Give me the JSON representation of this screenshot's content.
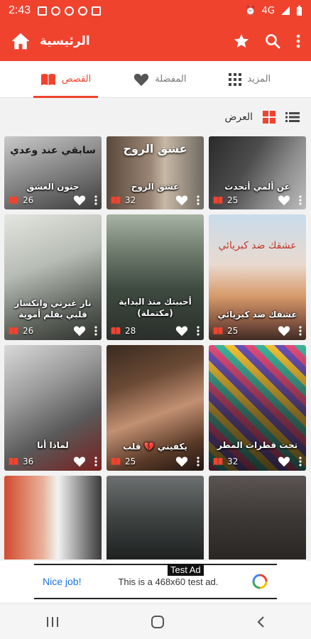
{
  "status_bar": {
    "time": "2:43",
    "signal": "4G"
  },
  "app_bar": {
    "title": "الرئيسية"
  },
  "tabs": [
    {
      "label": "المزيد"
    },
    {
      "label": "المفضلة"
    },
    {
      "label": "القصص"
    }
  ],
  "view": {
    "label": "العرض"
  },
  "stories": [
    {
      "title": "جنون العشق",
      "count": "26",
      "cover_text": "سابقي عند وعدي"
    },
    {
      "title": "عشق الروح",
      "count": "32",
      "cover_text": "عشق الروح"
    },
    {
      "title": "عن ألمي أتحدث",
      "count": "25",
      "cover_text": ""
    },
    {
      "title": "نار غيرتي وانكسار قلبي بقلم أموية",
      "count": "26",
      "cover_text": ""
    },
    {
      "title": "أحببتك منذ البداية (مكتملة)",
      "count": "28",
      "cover_text": ""
    },
    {
      "title": "عشقك ضد كبريائي",
      "count": "25",
      "cover_text": "عشقك ضد كبريائي"
    },
    {
      "title": "لماذا أنا",
      "count": "36",
      "cover_text": ""
    },
    {
      "title": "يكفيني 💔 قلب",
      "count": "25",
      "cover_text": ""
    },
    {
      "title": "تحت قطرات المطر",
      "count": "32",
      "cover_text": ""
    },
    {
      "title": "",
      "count": "",
      "cover_text": ""
    },
    {
      "title": "",
      "count": "",
      "cover_text": ""
    },
    {
      "title": "",
      "count": "",
      "cover_text": ""
    }
  ],
  "ad": {
    "tag": "Test Ad",
    "button": "Nice job!",
    "message": "This is a 468x60 test ad."
  },
  "colors": {
    "primary": "#f0432e",
    "tab_inactive": "#777777",
    "grid_active": "#f0432e"
  }
}
